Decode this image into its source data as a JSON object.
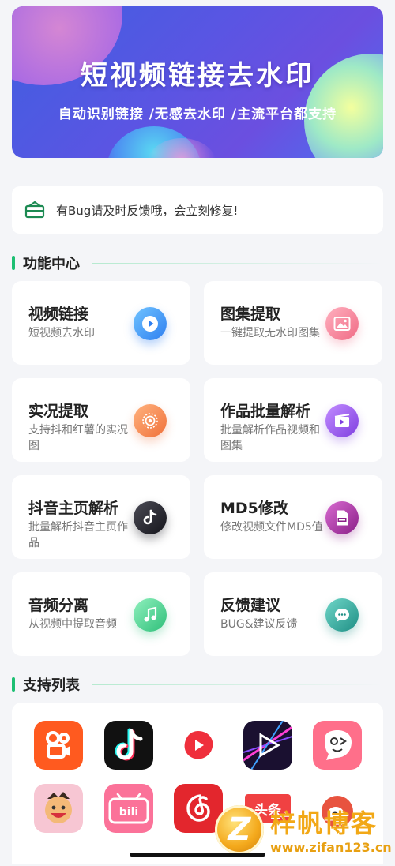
{
  "banner": {
    "title": "短视频链接去水印",
    "subtitle": "自动识别链接 /无感去水印 /主流平台都支持"
  },
  "notice": {
    "icon": "announcement-icon",
    "text": "有Bug请及时反馈哦，会立刻修复!"
  },
  "features_section": {
    "title": "功能中心"
  },
  "features": [
    {
      "title": "视频链接",
      "desc": "短视频去水印",
      "icon": "play-icon",
      "color": "#3a8ff0"
    },
    {
      "title": "图集提取",
      "desc": "一键提取无水印图集",
      "icon": "image-icon",
      "color": "#f27d93"
    },
    {
      "title": "实况提取",
      "desc": "支持抖和红薯的实况图",
      "icon": "live-photo-icon",
      "color": "#f58a4a"
    },
    {
      "title": "作品批量解析",
      "desc": "批量解析作品视频和图集",
      "icon": "video-clip-icon",
      "color": "#9a57e6"
    },
    {
      "title": "抖音主页解析",
      "desc": "批量解析抖音主页作品",
      "icon": "douyin-icon",
      "color": "#2b2b33"
    },
    {
      "title": "MD5修改",
      "desc": "修改视频文件MD5值",
      "icon": "md5-file-icon",
      "color": "#a2359e"
    },
    {
      "title": "音频分离",
      "desc": "从视频中提取音频",
      "icon": "music-note-icon",
      "color": "#46c98a"
    },
    {
      "title": "反馈建议",
      "desc": "BUG&建议反馈",
      "icon": "chat-bubble-icon",
      "color": "#2aa79b"
    }
  ],
  "support_section": {
    "title": "支持列表"
  },
  "platforms": [
    {
      "name": "kuaishou-app-icon",
      "color": "#ff5a1f"
    },
    {
      "name": "douyin-app-icon",
      "color": "#111111"
    },
    {
      "name": "weishi-app-icon",
      "color": "#ffffff"
    },
    {
      "name": "video-app-icon",
      "color": "#1a1030"
    },
    {
      "name": "pipixia-app-icon",
      "color": "#ff6f8a"
    },
    {
      "name": "zuiyou-app-icon",
      "color": "#f7c6d3"
    },
    {
      "name": "bilibili-app-icon",
      "color": "#fb7299"
    },
    {
      "name": "netease-music-app-icon",
      "color": "#e3262d"
    },
    {
      "name": "toutiao-app-icon",
      "color": "#f04142",
      "label": "头条"
    },
    {
      "name": "weibo-app-icon",
      "color": "#e8533f"
    }
  ],
  "watermark": {
    "logo_letter": "Z",
    "title": "梓帆博客",
    "url": "www.zifan123.cn"
  }
}
